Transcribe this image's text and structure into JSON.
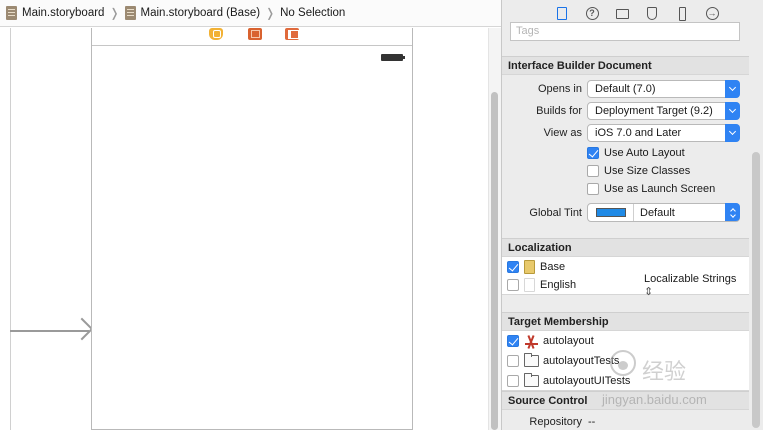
{
  "jump_bar": {
    "crumbs": [
      "Main.storyboard",
      "Main.storyboard (Base)",
      "No Selection"
    ],
    "separator": "❭"
  },
  "inspector": {
    "tabs": [
      {
        "name": "file-inspector-tab",
        "active": true
      },
      {
        "name": "quick-help-tab",
        "active": false
      },
      {
        "name": "identity-inspector-tab",
        "active": false
      },
      {
        "name": "attributes-inspector-tab",
        "active": false
      },
      {
        "name": "size-inspector-tab",
        "active": false
      },
      {
        "name": "connections-inspector-tab",
        "active": false
      }
    ],
    "tags_placeholder": "Tags",
    "ib_document": {
      "title": "Interface Builder Document",
      "opens_in_label": "Opens in",
      "opens_in_value": "Default (7.0)",
      "builds_for_label": "Builds for",
      "builds_for_value": "Deployment Target (9.2)",
      "view_as_label": "View as",
      "view_as_value": "iOS 7.0 and Later",
      "options": [
        {
          "label": "Use Auto Layout",
          "checked": true
        },
        {
          "label": "Use Size Classes",
          "checked": false
        },
        {
          "label": "Use as Launch Screen",
          "checked": false
        }
      ],
      "global_tint_label": "Global Tint",
      "global_tint_value": "Default",
      "global_tint_color": "#1f8ae6"
    },
    "localization": {
      "title": "Localization",
      "items": [
        {
          "label": "Base",
          "checked": true,
          "value": ""
        },
        {
          "label": "English",
          "checked": false,
          "value": "Localizable Strings"
        }
      ]
    },
    "target_membership": {
      "title": "Target Membership",
      "items": [
        {
          "label": "autolayout",
          "checked": true
        },
        {
          "label": "autolayoutTests",
          "checked": false
        },
        {
          "label": "autolayoutUITests",
          "checked": false
        }
      ]
    },
    "source_control": {
      "title": "Source Control",
      "repository_label": "Repository",
      "repository_value": "--"
    }
  },
  "watermark": {
    "chinese": "经验",
    "url": "jingyan.baidu.com"
  },
  "colors": {
    "accent": "#2f83f3",
    "section_header": "#e2e2e2",
    "inspector_bg": "#ececec"
  }
}
